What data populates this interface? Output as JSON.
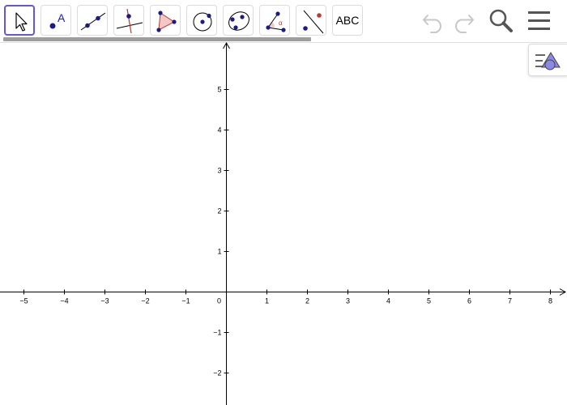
{
  "toolbar": {
    "tools": [
      {
        "name": "move-tool",
        "icon": "arrow-cursor-icon",
        "selected": true
      },
      {
        "name": "point-tool",
        "icon": "point-icon",
        "label": "A"
      },
      {
        "name": "line-tool",
        "icon": "line-through-two-points-icon"
      },
      {
        "name": "perpendicular-line-tool",
        "icon": "perpendicular-line-icon"
      },
      {
        "name": "polygon-tool",
        "icon": "polygon-icon"
      },
      {
        "name": "circle-tool",
        "icon": "circle-center-point-icon"
      },
      {
        "name": "conic-tool",
        "icon": "conic-through-points-icon"
      },
      {
        "name": "angle-tool",
        "icon": "angle-icon",
        "label": "α"
      },
      {
        "name": "reflect-tool",
        "icon": "reflect-about-line-icon"
      },
      {
        "name": "text-tool",
        "icon": "text-icon",
        "label": "ABC"
      }
    ],
    "controls": [
      "undo-icon",
      "redo-icon",
      "search-icon",
      "menu-icon"
    ]
  },
  "graphics": {
    "x_ticks": [
      "−5",
      "−4",
      "−3",
      "−2",
      "−1",
      "0",
      "1",
      "2",
      "3",
      "4",
      "5",
      "6",
      "7",
      "8"
    ],
    "x_values": [
      -5,
      -4,
      -3,
      -2,
      -1,
      0,
      1,
      2,
      3,
      4,
      5,
      6,
      7,
      8
    ],
    "y_ticks": [
      "5",
      "4",
      "3",
      "2",
      "1",
      "−1",
      "−2"
    ],
    "y_values": [
      5,
      4,
      3,
      2,
      1,
      -1,
      -2
    ]
  },
  "colors": {
    "point": "#1a1a8c",
    "accent": "#6557d2",
    "polygon_fill": "#f4c6c6",
    "polygon_stroke": "#c0392b",
    "axis": "#000000"
  }
}
